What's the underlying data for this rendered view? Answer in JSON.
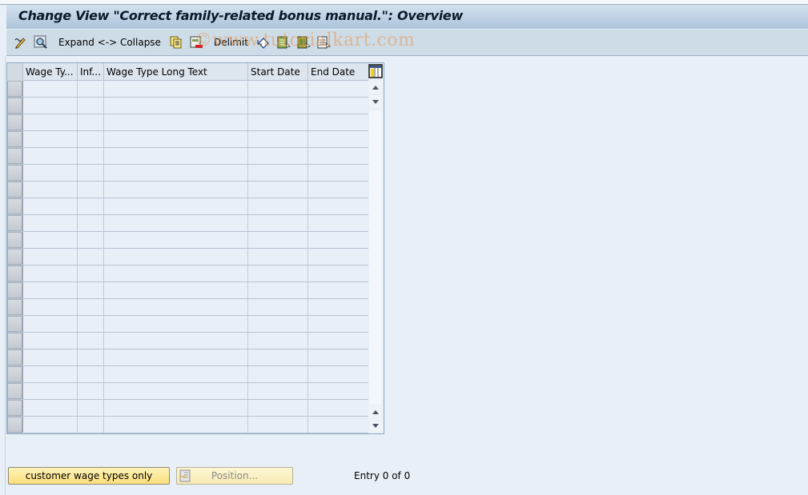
{
  "window": {
    "title": "Change View \"Correct family-related bonus manual.\": Overview"
  },
  "toolbar": {
    "items": [
      {
        "type": "icon",
        "name": "change-display-toggle-icon"
      },
      {
        "type": "icon",
        "name": "find-icon"
      },
      {
        "type": "text",
        "label": "Expand <-> Collapse"
      },
      {
        "type": "icon",
        "name": "copy-as-icon"
      },
      {
        "type": "icon",
        "name": "delete-icon"
      },
      {
        "type": "text",
        "label": "Delimit"
      },
      {
        "type": "icon",
        "name": "undo-change-icon"
      },
      {
        "type": "icon",
        "name": "select-all-icon"
      },
      {
        "type": "icon",
        "name": "select-block-icon"
      },
      {
        "type": "icon",
        "name": "deselect-all-icon"
      }
    ],
    "expand_collapse_label": "Expand <-> Collapse",
    "delimit_label": "Delimit"
  },
  "watermark": "©www.tutorialkart.com",
  "table": {
    "columns": [
      "Wage Ty...",
      "Inf...",
      "Wage Type Long Text",
      "Start Date",
      "End Date"
    ],
    "visible_empty_rows": 21,
    "rows": []
  },
  "footer": {
    "customer_button_label": "customer wage types only",
    "position_button_label": "Position...",
    "entry_text": "Entry 0 of 0"
  },
  "colors": {
    "title_gradient_top": "#d3e1ee",
    "title_gradient_bottom": "#adc4db",
    "toolbar_bg": "#cedce7",
    "page_bg": "#e8eff7",
    "button_yellow": "#fbdf7c",
    "table_border": "#8aaac8"
  }
}
